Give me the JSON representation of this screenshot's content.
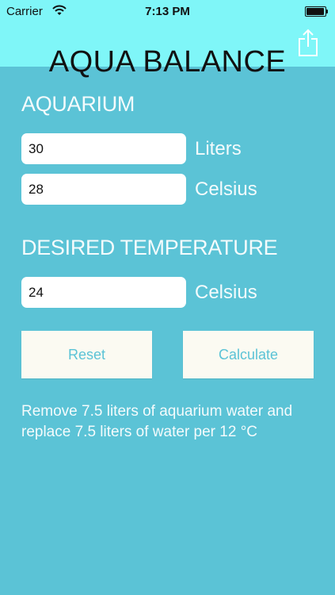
{
  "status_bar": {
    "carrier": "Carrier",
    "time": "7:13 PM"
  },
  "header": {
    "title": "AQUA BALANCE",
    "share_icon": "share-icon"
  },
  "aquarium": {
    "heading": "AQUARIUM",
    "volume_value": "30",
    "volume_unit": "Liters",
    "temperature_value": "28",
    "temperature_unit": "Celsius"
  },
  "desired": {
    "heading": "DESIRED TEMPERATURE",
    "temperature_value": "24",
    "temperature_unit": "Celsius"
  },
  "actions": {
    "reset_label": "Reset",
    "calculate_label": "Calculate"
  },
  "result": {
    "message": "Remove 7.5 liters of aquarium water and replace 7.5 liters of water per 12 °C"
  },
  "colors": {
    "header_background": "#7ff6f8",
    "body_background": "#5bc3d6",
    "button_background": "#fbfaf2",
    "text_light": "#f4fbfc"
  }
}
